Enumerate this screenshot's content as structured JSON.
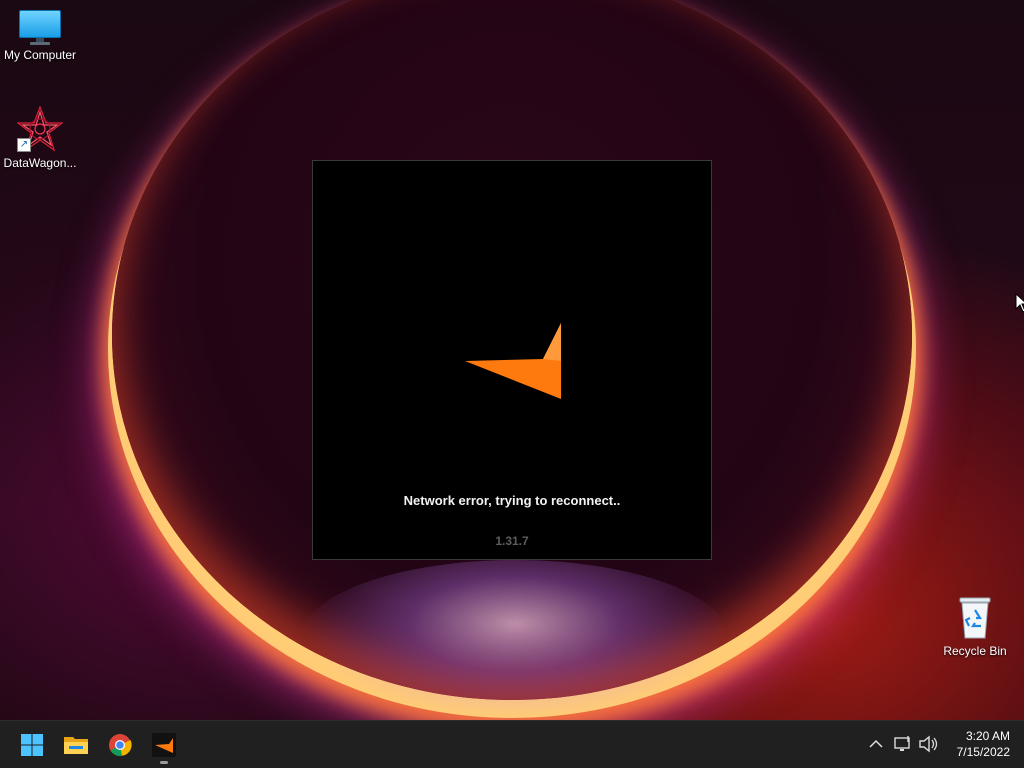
{
  "desktop": {
    "icons": [
      {
        "label": "My Computer",
        "icon": "monitor-icon"
      },
      {
        "label": "DataWagon...",
        "icon": "starburst-shortcut-icon"
      },
      {
        "label": "Recycle Bin",
        "icon": "recycle-bin-icon"
      }
    ]
  },
  "app_window": {
    "logo_icon": "orange-arrow-logo-icon",
    "status": "Network error, trying to reconnect..",
    "version": "1.31.7",
    "accent": "#ff7a0e"
  },
  "taskbar": {
    "items": [
      {
        "name": "start",
        "icon": "windows-logo-icon"
      },
      {
        "name": "file-explorer",
        "icon": "folder-icon"
      },
      {
        "name": "chrome",
        "icon": "chrome-icon"
      },
      {
        "name": "app",
        "icon": "orange-arrow-logo-icon",
        "running": true
      }
    ],
    "tray": {
      "icons": [
        "chevron-up-icon",
        "network-icon",
        "speaker-icon"
      ],
      "time": "3:20 AM",
      "date": "7/15/2022"
    }
  }
}
